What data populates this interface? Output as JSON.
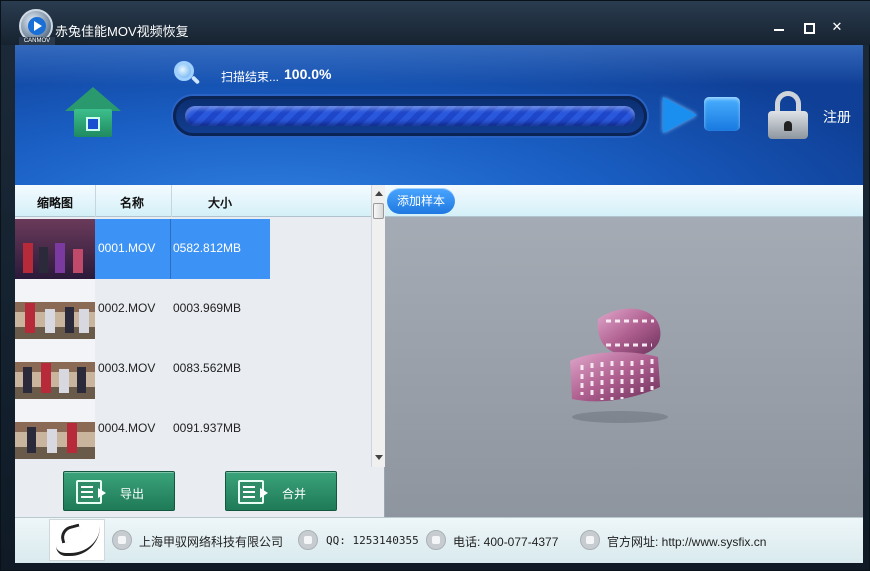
{
  "window": {
    "title": "赤兔佳能MOV视频恢复",
    "logo_text": "CANMOV"
  },
  "header": {
    "scan_status": "扫描结束...",
    "scan_percent": "100.0%",
    "progress": 1.0,
    "register_label": "注册"
  },
  "file_list": {
    "columns": [
      "缩略图",
      "名称",
      "大小"
    ],
    "rows": [
      {
        "name": "0001.MOV",
        "size": "0582.812MB",
        "selected": true
      },
      {
        "name": "0002.MOV",
        "size": "0003.969MB",
        "selected": false
      },
      {
        "name": "0003.MOV",
        "size": "0083.562MB",
        "selected": false
      },
      {
        "name": "0004.MOV",
        "size": "0091.937MB",
        "selected": false
      }
    ]
  },
  "actions": {
    "export_label": "导出",
    "merge_label": "合并"
  },
  "preview": {
    "add_sample_label": "添加样本"
  },
  "footer": {
    "company": "上海甲驭网络科技有限公司",
    "qq": "QQ: 1253140355",
    "phone": "电话: 400-077-4377",
    "website": "官方网址: http://www.sysfix.cn"
  },
  "colors": {
    "header_blue": "#1a5fc4",
    "selection_blue": "#3d93f5",
    "button_green": "#2f8c66",
    "film_purple": "#b06090"
  }
}
